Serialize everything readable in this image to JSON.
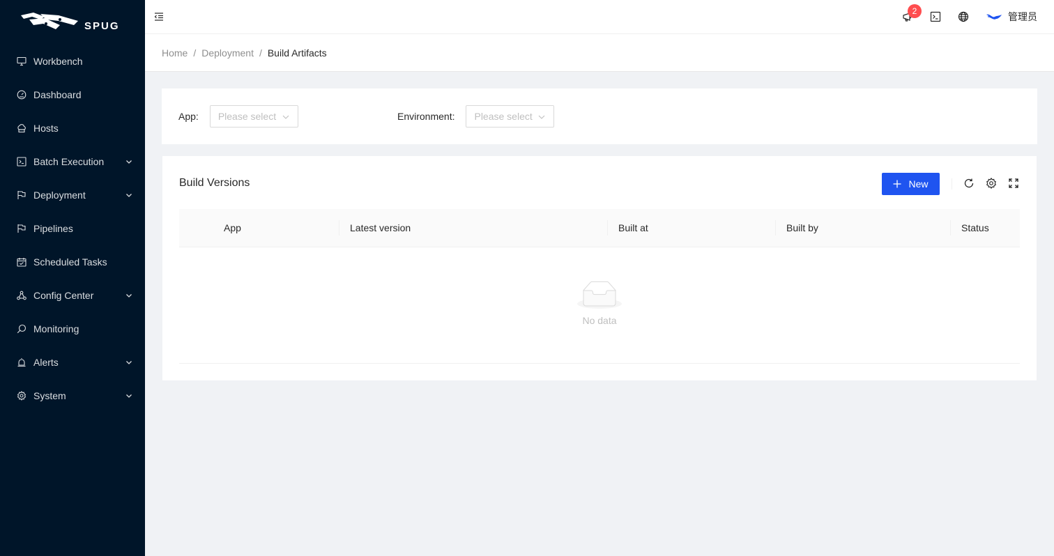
{
  "app": {
    "brand": "SPUG"
  },
  "sidebar": {
    "items": [
      {
        "label": "Workbench",
        "icon": "desktop-icon",
        "submenu": false
      },
      {
        "label": "Dashboard",
        "icon": "dashboard-icon",
        "submenu": false
      },
      {
        "label": "Hosts",
        "icon": "cloud-server-icon",
        "submenu": false
      },
      {
        "label": "Batch Execution",
        "icon": "code-icon",
        "submenu": true
      },
      {
        "label": "Deployment",
        "icon": "flag-icon",
        "submenu": true
      },
      {
        "label": "Pipelines",
        "icon": "pipeline-icon",
        "submenu": false
      },
      {
        "label": "Scheduled Tasks",
        "icon": "schedule-icon",
        "submenu": false
      },
      {
        "label": "Config Center",
        "icon": "deployment-unit-icon",
        "submenu": true
      },
      {
        "label": "Monitoring",
        "icon": "monitor-icon",
        "submenu": false
      },
      {
        "label": "Alerts",
        "icon": "alert-icon",
        "submenu": true
      },
      {
        "label": "System",
        "icon": "setting-icon",
        "submenu": true
      }
    ]
  },
  "header": {
    "notification_count": "2",
    "user_name": "管理员"
  },
  "breadcrumb": {
    "items": [
      "Home",
      "Deployment",
      "Build Artifacts"
    ],
    "separator": "/"
  },
  "filters": {
    "app_label": "App",
    "app_placeholder": "Please select",
    "env_label": "Environment",
    "env_placeholder": "Please select"
  },
  "table": {
    "title": "Build Versions",
    "new_button": "New",
    "columns": [
      "App",
      "Latest version",
      "Built at",
      "Built by",
      "Status"
    ],
    "rows": [],
    "empty_text": "No data"
  },
  "colors": {
    "sidebar_bg": "#001529",
    "primary": "#1f54f0",
    "badge": "#ff4d4f",
    "page_bg": "#f0f2f5"
  }
}
